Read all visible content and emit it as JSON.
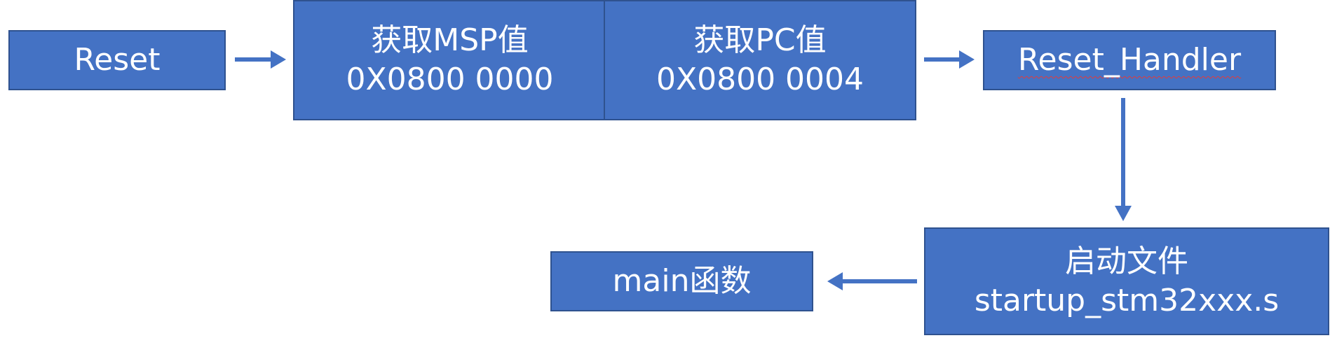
{
  "nodes": {
    "reset": {
      "label": "Reset"
    },
    "get_msp": {
      "line1": "获取MSP值",
      "line2": "0X0800 0000"
    },
    "get_pc": {
      "line1": "获取PC值",
      "line2": "0X0800 0004"
    },
    "reset_handler": {
      "label": "Reset_Handler"
    },
    "startup_file": {
      "line1": "启动文件",
      "line2": "startup_stm32xxx.s"
    },
    "main_function": {
      "label": "main函数"
    }
  },
  "colors": {
    "box_fill": "#4472c4",
    "box_border": "#2f528f",
    "arrow": "#4472c4",
    "text": "#ffffff"
  }
}
